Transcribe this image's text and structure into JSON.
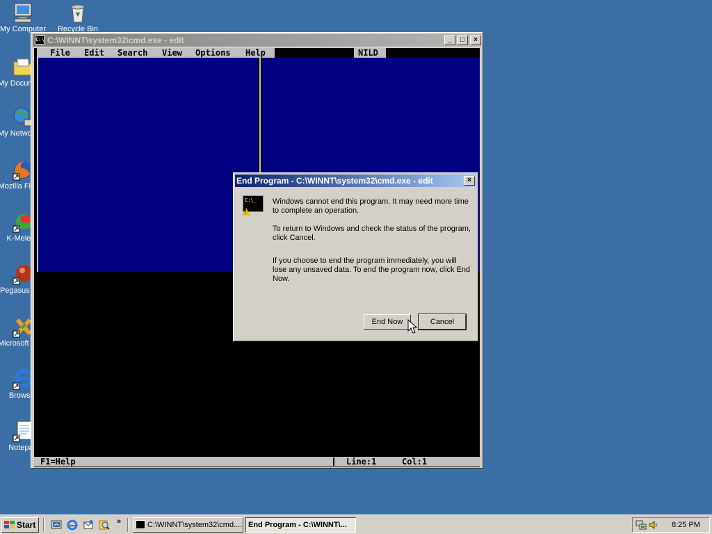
{
  "desktop": {
    "icons": [
      {
        "label": "My Computer"
      },
      {
        "label": "Recycle Bin"
      },
      {
        "label": "My Documents"
      },
      {
        "label": "My Network Places"
      },
      {
        "label": "Mozilla Firefox"
      },
      {
        "label": "K-Meleon"
      },
      {
        "label": "Pegasus Mail"
      },
      {
        "label": "Microsoft Visual Studio"
      },
      {
        "label": "Browser"
      },
      {
        "label": "Notepad"
      }
    ]
  },
  "cmd_window": {
    "title": "C:\\WINNT\\system32\\cmd.exe - edit",
    "icon_text": "C:\\",
    "minimize": "_",
    "maximize": "□",
    "close": "×",
    "menu": [
      "File",
      "Edit",
      "Search",
      "View",
      "Options",
      "Help"
    ],
    "file_name": "NILD",
    "status_help": "F1=Help",
    "status_line": "Line:1",
    "status_col": "Col:1"
  },
  "dialog": {
    "title": "End Program - C:\\WINNT\\system32\\cmd.exe - edit",
    "close": "×",
    "icon_text": "C:\\_",
    "warning_glyph": "!",
    "para1": "Windows cannot end this program. It may need more time to complete an operation.",
    "para2": "To return to Windows and check the status of the program, click Cancel.",
    "para3": "If you choose to end the program immediately, you will lose any unsaved data. To end the program now, click End Now.",
    "end_now": "End Now",
    "cancel": "Cancel"
  },
  "taskbar": {
    "start": "Start",
    "quick_launch_more": "»",
    "tasks": [
      {
        "label": "C:\\WINNT\\system32\\cmd...."
      },
      {
        "label": "End Program - C:\\WINNT\\..."
      }
    ],
    "clock": "8:25 PM"
  },
  "colors": {
    "desktop": "#3a6ea5",
    "console_blue": "#000080",
    "dialog_title": "#0a246a"
  }
}
